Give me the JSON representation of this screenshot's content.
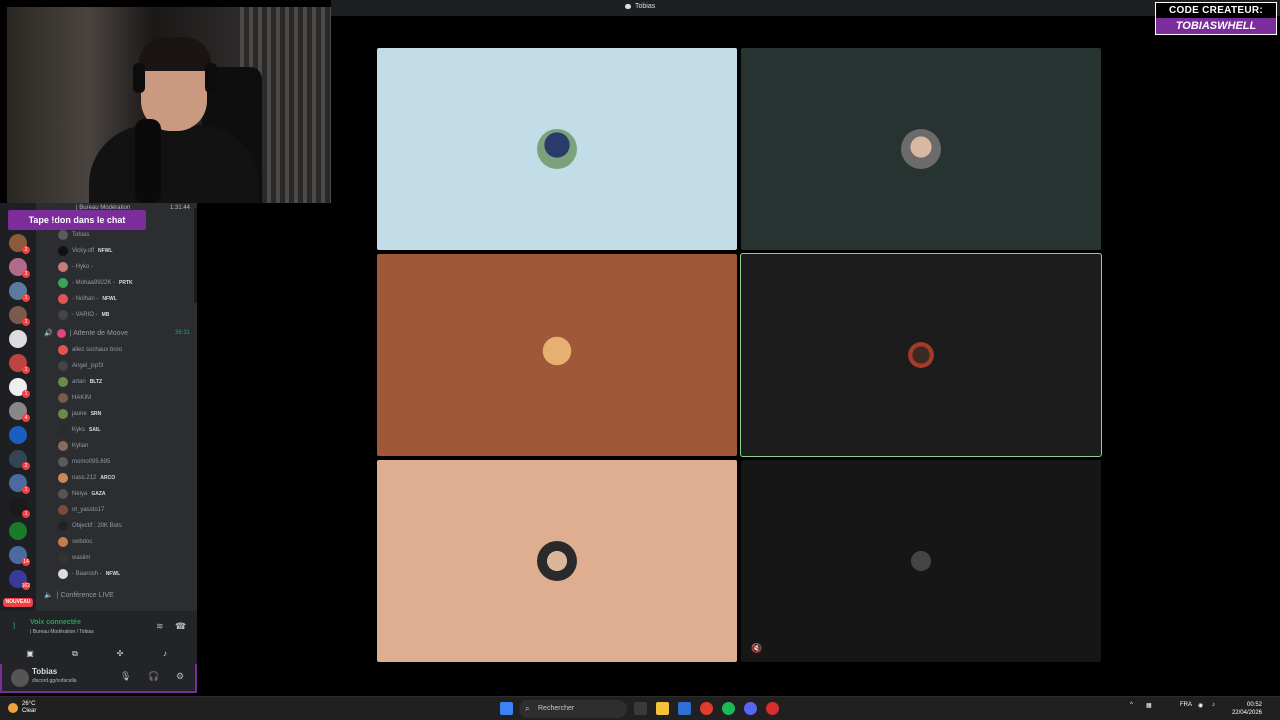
{
  "window": {
    "title": "Tobias"
  },
  "overlay": {
    "creator_line1": "CODE CREATEUR:",
    "creator_line2": "TOBIASWHELL"
  },
  "sidebar": {
    "banner": "Tape !don dans le chat",
    "top_channel": "| Bureau Modération",
    "top_channel_time": "1:31:44",
    "server_badges": [
      "2",
      "3",
      "1",
      "1",
      "",
      "1",
      "1",
      "4",
      "",
      "2",
      "1",
      "1",
      "",
      "14",
      "162"
    ],
    "new_label": "NOUVEAU",
    "first_member": "Tobias",
    "members_top": [
      {
        "name": "Vicky.off",
        "tag": "NFWL"
      },
      {
        "name": "- Hyko -",
        "tag": ""
      },
      {
        "name": "- Mohaa9922K -",
        "tag": "PRTK"
      },
      {
        "name": "- Nolhan -",
        "tag": "NFWL"
      },
      {
        "name": "- VARIO -",
        "tag": "MB"
      }
    ],
    "channel_attente": "| Attente de Moove",
    "channel_attente_time": "36:31",
    "members_attente": [
      {
        "name": "allez sochaux broo",
        "tag": ""
      },
      {
        "name": "Angel_jspf3",
        "tag": ""
      },
      {
        "name": "artan",
        "tag": "BLTZ"
      },
      {
        "name": "HAKIM",
        "tag": ""
      },
      {
        "name": "jaune",
        "tag": "SRN"
      },
      {
        "name": "Kyks",
        "tag": "SAIL"
      },
      {
        "name": "Kylian",
        "tag": ""
      },
      {
        "name": "momo095.695",
        "tag": ""
      },
      {
        "name": "nass.212",
        "tag": "ARCO"
      },
      {
        "name": "Neiya",
        "tag": "GAZA"
      },
      {
        "name": "ot_yassto17",
        "tag": ""
      },
      {
        "name": "Objectif : 20K Bots",
        "tag": ""
      },
      {
        "name": "swbdoc",
        "tag": ""
      },
      {
        "name": "wasiim",
        "tag": ""
      },
      {
        "name": "- Baarosh -",
        "tag": "NFWL"
      }
    ],
    "channel_conf": "| Conférence LIVE",
    "voice_status": "Voix connectée",
    "voice_sub": "| Bureau Modération / Tobias",
    "user_name": "Tobias",
    "user_status": "discord.gg/nofacella"
  },
  "colors": {
    "tile1": "#c2dde7",
    "tile2": "#273331",
    "tile3": "#9f5838",
    "tile4": "#1c1c1c",
    "tile5": "#dfae91",
    "tile6": "#161616",
    "accent": "#7b2d9c",
    "speaking": "#8fd18f"
  },
  "taskbar": {
    "temp": "26°C",
    "weather": "Clear",
    "search_placeholder": "Rechercher",
    "lang": "FRA",
    "time": "00:52",
    "date": "22/04/2026"
  }
}
